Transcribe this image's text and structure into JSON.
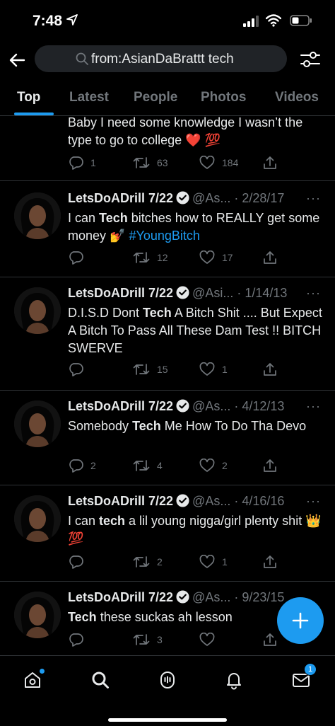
{
  "status_bar": {
    "time": "7:48"
  },
  "search": {
    "query": "from:AsianDaBrattt tech"
  },
  "tabs": [
    {
      "label": "Top",
      "active": true
    },
    {
      "label": "Latest"
    },
    {
      "label": "People"
    },
    {
      "label": "Photos"
    },
    {
      "label": "Videos"
    }
  ],
  "partial_tweet": {
    "text": "Baby I need some knowledge I wasn’t the type to go to college ❤️ 💯",
    "replies": "1",
    "retweets": "63",
    "likes": "184"
  },
  "tweets": [
    {
      "name": "LetsDoADrill 7/22",
      "handle": "@As...",
      "date": "2/28/17",
      "pre": "I can ",
      "kw": "Tech",
      "post": " bitches how to REALLY get some money 💅 ",
      "hashtag": "#YoungBitch",
      "replies": "",
      "retweets": "12",
      "likes": "17"
    },
    {
      "name": "LetsDoADrill 7/22",
      "handle": "@Asi...",
      "date": "1/14/13",
      "pre": "D.I.S.D Dont ",
      "kw": "Tech",
      "post": " A Bitch Shit .... But Expect A Bitch To Pass All These Dam Test !! BITCH SWERVE",
      "hashtag": "",
      "replies": "",
      "retweets": "15",
      "likes": "1"
    },
    {
      "name": "LetsDoADrill 7/22",
      "handle": "@As...",
      "date": "4/12/13",
      "pre": "Somebody ",
      "kw": "Tech",
      "post": " Me How To Do Tha Devo",
      "hashtag": "",
      "replies": "2",
      "retweets": "4",
      "likes": "2"
    },
    {
      "name": "LetsDoADrill 7/22",
      "handle": "@As...",
      "date": "4/16/16",
      "pre": "I can ",
      "kw": "tech",
      "post": " a lil young nigga/girl plenty shit 👑 💯",
      "hashtag": "",
      "replies": "",
      "retweets": "2",
      "likes": "1"
    },
    {
      "name": "LetsDoADrill 7/22",
      "handle": "@As...",
      "date": "9/23/15",
      "pre": "",
      "kw": "Tech",
      "post": " these suckas ah lesson",
      "hashtag": "",
      "replies": "",
      "retweets": "3",
      "likes": ""
    }
  ],
  "bottom_nav": {
    "items": [
      "home-icon",
      "search-icon",
      "spaces-icon",
      "notifications-icon",
      "messages-icon"
    ],
    "messages_badge": "1"
  },
  "colors": {
    "accent": "#1d9bf0",
    "background": "#000000",
    "muted": "#71767b"
  }
}
